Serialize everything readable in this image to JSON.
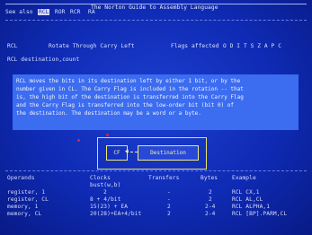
{
  "window": {
    "title": "The Norton Guide to Assembly Language",
    "menu": [
      {
        "label": "See also",
        "selected": false
      },
      {
        "label": "RCL",
        "selected": true
      },
      {
        "label": "ROR",
        "selected": false
      },
      {
        "label": "RCR",
        "selected": false
      },
      {
        "label": "RA",
        "selected": false
      }
    ]
  },
  "instruction": {
    "mnemonic": "RCL",
    "name": "Rotate Through Carry Left",
    "flags_label": "Flags affected",
    "flags_value": "O D I T S Z A P C",
    "syntax": "RCL destination,count",
    "description_lines": [
      "RCL moves the bits in its destination left by either 1 bit, or by the",
      "number given in CL. The Carry Flag is included in the rotation -- that",
      "is, the high bit of the destination is transferred into the Carry Flag",
      "and the Carry Flag is transferred into the low-order bit (bit 0) of",
      "the destination. The destination may be a word or a byte."
    ],
    "diagram": {
      "cf_label": "CF",
      "destination_label": "Destination"
    }
  },
  "table": {
    "headers": {
      "operands": "Operands",
      "clocks": "Clocks",
      "clocks_sub": "bust(w,b)",
      "transfers": "Transfers",
      "bytes": "Bytes",
      "example": "Example"
    },
    "rows": [
      {
        "operands": "register, 1",
        "clocks": "2",
        "transfers": "-",
        "bytes": "2",
        "example": "RCL CX,1"
      },
      {
        "operands": "register, CL",
        "clocks": "8 + 4/bit",
        "transfers": "-",
        "bytes": "2",
        "example": "RCL AL,CL"
      },
      {
        "operands": "memory, 1",
        "clocks": "15(23) + EA",
        "transfers": "2",
        "bytes": "2-4",
        "example": "RCL ALPHA,1"
      },
      {
        "operands": "memory, CL",
        "clocks": "20(28)+EA+4/bit",
        "transfers": "2",
        "bytes": "2-4",
        "example": "RCL [BP].PARM,CL"
      }
    ]
  },
  "colors": {
    "background": "#1d3fd0",
    "text": "#d8e0ff",
    "highlight_panel": "#3c6cf0",
    "diagram": "#f0e978",
    "accent": "#d52c3a"
  }
}
